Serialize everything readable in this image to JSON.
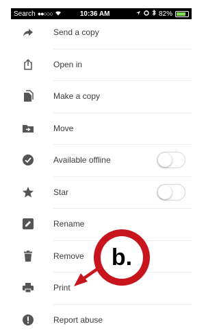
{
  "status_bar": {
    "carrier": "Search",
    "signal": "●●○○○",
    "time": "10:36 AM",
    "battery": "82%",
    "battery_level": 0.82
  },
  "menu": {
    "items": [
      {
        "label": "Send a copy",
        "icon": "share-arrow-icon"
      },
      {
        "label": "Open in",
        "icon": "open-in-icon"
      },
      {
        "label": "Make a copy",
        "icon": "copy-icon"
      },
      {
        "label": "Move",
        "icon": "move-folder-icon"
      },
      {
        "label": "Available offline",
        "icon": "offline-check-icon",
        "toggle": false
      },
      {
        "label": "Star",
        "icon": "star-icon",
        "toggle": false
      },
      {
        "label": "Rename",
        "icon": "rename-icon"
      },
      {
        "label": "Remove",
        "icon": "trash-icon"
      },
      {
        "label": "Print",
        "icon": "printer-icon"
      },
      {
        "label": "Report abuse",
        "icon": "report-icon"
      }
    ]
  },
  "annotation": {
    "label": "b.",
    "color": "#c8141c"
  },
  "colors": {
    "icon": "#555555",
    "text": "#3b3b3b"
  }
}
